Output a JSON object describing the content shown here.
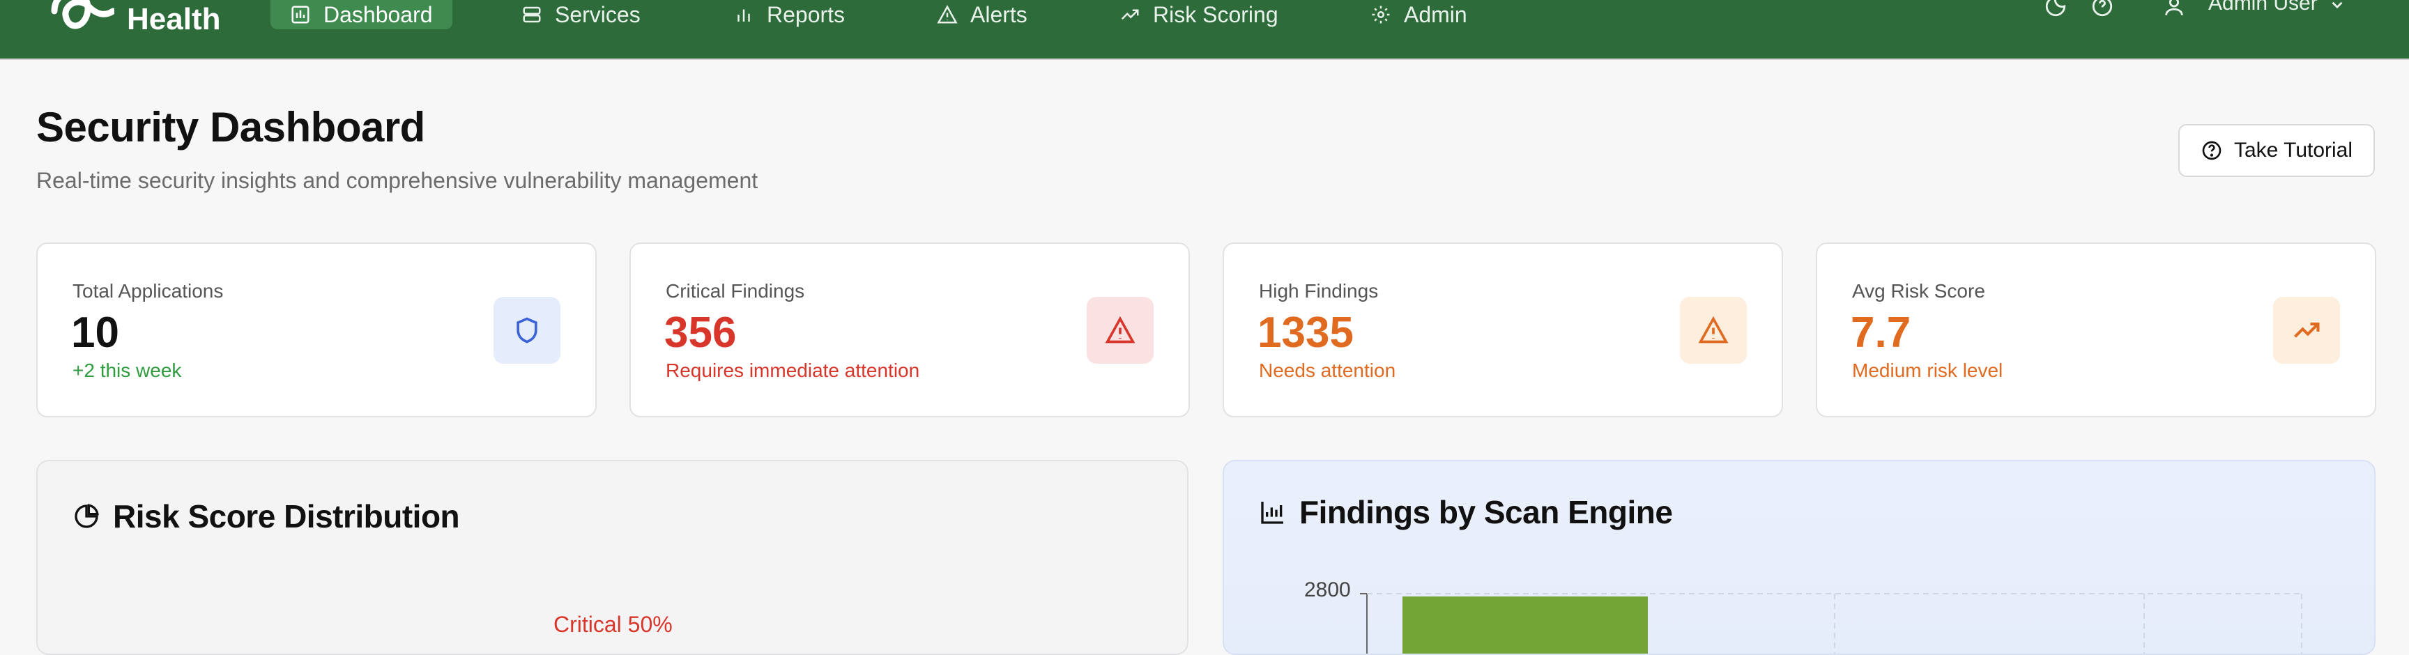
{
  "nav": {
    "brand": "Health",
    "items": [
      {
        "label": "Dashboard",
        "icon": "dashboard-icon",
        "active": true
      },
      {
        "label": "Services",
        "icon": "server-icon"
      },
      {
        "label": "Reports",
        "icon": "bar-chart-icon"
      },
      {
        "label": "Alerts",
        "icon": "warning-icon"
      },
      {
        "label": "Risk Scoring",
        "icon": "trend-icon"
      },
      {
        "label": "Admin",
        "icon": "gear-icon"
      }
    ],
    "user": "Admin User",
    "colors": {
      "bar": "#2e6b3b",
      "active": "#3f8a4e"
    }
  },
  "header": {
    "title": "Security Dashboard",
    "subtitle": "Real-time security insights and comprehensive vulnerability management",
    "tutorial_label": "Take Tutorial"
  },
  "stats": [
    {
      "label": "Total Applications",
      "value": "10",
      "sub": "+2 this week",
      "icon": "shield-icon",
      "color": "#2e9c3f",
      "valueColor": "#111111",
      "iconBg": "#e5ecfb",
      "iconColor": "#3b63d6"
    },
    {
      "label": "Critical Findings",
      "value": "356",
      "sub": "Requires immediate attention",
      "icon": "warning-icon",
      "color": "#d9362b",
      "valueColor": "#d9362b",
      "iconBg": "#fbe2e2",
      "iconColor": "#d9362b"
    },
    {
      "label": "High Findings",
      "value": "1335",
      "sub": "Needs attention",
      "icon": "warning-icon",
      "color": "#e06a1f",
      "valueColor": "#e06a1f",
      "iconBg": "#fdeedd",
      "iconColor": "#e06a1f"
    },
    {
      "label": "Avg Risk Score",
      "value": "7.7",
      "sub": "Medium risk level",
      "icon": "trend-up-icon",
      "color": "#e06a1f",
      "valueColor": "#e06a1f",
      "iconBg": "#fdeedd",
      "iconColor": "#e06a1f"
    }
  ],
  "panels": {
    "risk": {
      "title": "Risk Score Distribution",
      "icon": "pie-chart-icon",
      "slice_label": "Critical 50%"
    },
    "engine": {
      "title": "Findings by Scan Engine",
      "icon": "bar-chart-icon"
    }
  },
  "chart_data": [
    {
      "type": "pie",
      "title": "Risk Score Distribution",
      "slices": [
        {
          "label": "Critical",
          "value": 50
        }
      ]
    },
    {
      "type": "bar",
      "title": "Findings by Scan Engine",
      "yticks": [
        "2800"
      ],
      "values": [
        2800
      ],
      "colors": [
        "#73a534"
      ]
    }
  ]
}
